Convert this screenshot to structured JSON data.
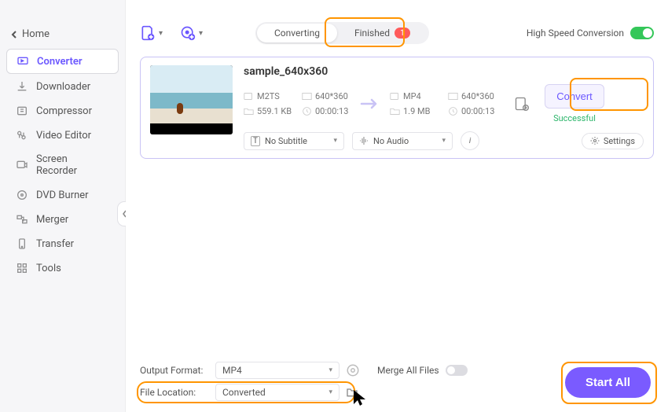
{
  "window": {
    "back_label": "Home"
  },
  "sidebar": {
    "items": [
      {
        "label": "Converter"
      },
      {
        "label": "Downloader"
      },
      {
        "label": "Compressor"
      },
      {
        "label": "Video Editor"
      },
      {
        "label": "Screen Recorder"
      },
      {
        "label": "DVD Burner"
      },
      {
        "label": "Merger"
      },
      {
        "label": "Transfer"
      },
      {
        "label": "Tools"
      }
    ]
  },
  "tabs": {
    "converting": "Converting",
    "finished": "Finished",
    "finished_badge": "1"
  },
  "hsc_label": "High Speed Conversion",
  "file": {
    "name": "sample_640x360",
    "src_format": "M2TS",
    "src_res": "640*360",
    "src_size": "559.1 KB",
    "src_duration": "00:00:13",
    "dst_format": "MP4",
    "dst_res": "640*360",
    "dst_size": "1.9 MB",
    "dst_duration": "00:00:13",
    "subtitle": "No Subtitle",
    "audio": "No Audio",
    "settings_label": "Settings",
    "convert_label": "Convert",
    "status": "Successful"
  },
  "footer": {
    "output_format_label": "Output Format:",
    "output_format_value": "MP4",
    "file_location_label": "File Location:",
    "file_location_value": "Converted",
    "merge_label": "Merge All Files",
    "start_all": "Start All"
  }
}
